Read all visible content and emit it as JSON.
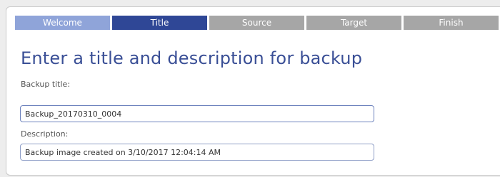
{
  "wizard": {
    "steps": [
      {
        "label": "Welcome",
        "state": "done"
      },
      {
        "label": "Title",
        "state": "active"
      },
      {
        "label": "Source",
        "state": "pending"
      },
      {
        "label": "Target",
        "state": "pending"
      },
      {
        "label": "Finish",
        "state": "pending"
      }
    ]
  },
  "page": {
    "heading": "Enter a title and description for backup"
  },
  "form": {
    "title_label": "Backup title:",
    "title_value": "Backup_20170310_0004",
    "description_label": "Description:",
    "description_value": "Backup image created on 3/10/2017 12:04:14 AM"
  },
  "colors": {
    "step_done": "#8fa4d9",
    "step_active": "#2f4796",
    "step_pending": "#a6a6a6",
    "heading": "#3a4f96"
  }
}
